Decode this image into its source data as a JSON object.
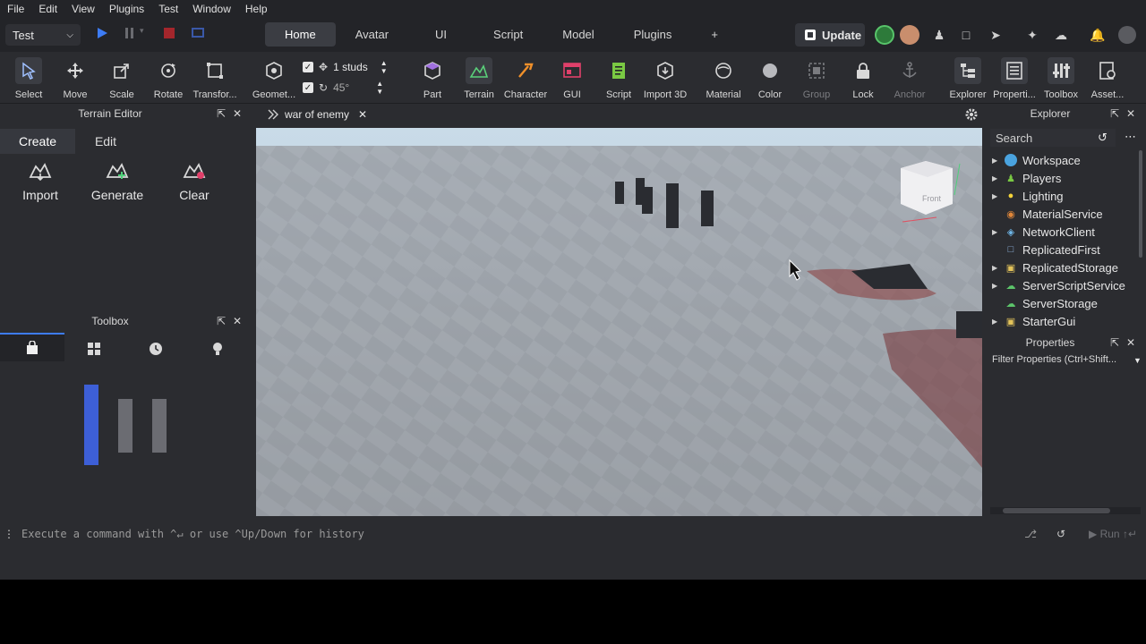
{
  "menu": [
    "File",
    "Edit",
    "View",
    "Plugins",
    "Test",
    "Window",
    "Help"
  ],
  "test_select": {
    "value": "Test"
  },
  "tabs": [
    "Home",
    "Avatar",
    "UI",
    "Script",
    "Model",
    "Plugins",
    "+"
  ],
  "active_tab": "Home",
  "update_label": "Update",
  "ribbon": {
    "tools": [
      {
        "label": "Select",
        "icon": "select-cursor-icon"
      },
      {
        "label": "Move",
        "icon": "move-arrows-icon"
      },
      {
        "label": "Scale",
        "icon": "scale-icon"
      },
      {
        "label": "Rotate",
        "icon": "rotate-icon"
      },
      {
        "label": "Transfor...",
        "icon": "transform-icon"
      },
      {
        "label": "Geomet...",
        "icon": "geometry-icon"
      }
    ],
    "snap_move": "1 studs",
    "snap_rotate": "45°",
    "insert": [
      {
        "label": "Part",
        "icon": "part-icon"
      },
      {
        "label": "Terrain",
        "icon": "terrain-icon"
      },
      {
        "label": "Character",
        "icon": "character-icon"
      },
      {
        "label": "GUI",
        "icon": "gui-icon"
      },
      {
        "label": "Script",
        "icon": "script-icon"
      },
      {
        "label": "Import 3D",
        "icon": "import-3d-icon"
      },
      {
        "label": "Material",
        "icon": "material-icon"
      },
      {
        "label": "Color",
        "icon": "color-icon"
      },
      {
        "label": "Group",
        "icon": "group-icon"
      },
      {
        "label": "Lock",
        "icon": "lock-icon"
      },
      {
        "label": "Anchor",
        "icon": "anchor-icon"
      },
      {
        "label": "Explorer",
        "icon": "explorer-icon"
      },
      {
        "label": "Properti...",
        "icon": "properties-icon"
      },
      {
        "label": "Toolbox",
        "icon": "toolbox-icon"
      },
      {
        "label": "Asset...",
        "icon": "asset-manager-icon"
      }
    ]
  },
  "terrain_editor": {
    "title": "Terrain Editor",
    "tabs": [
      "Create",
      "Edit"
    ],
    "actions": [
      "Import",
      "Generate",
      "Clear"
    ]
  },
  "toolbox": {
    "title": "Toolbox"
  },
  "document_tab": "war of enemy",
  "explorer": {
    "title": "Explorer",
    "search_placeholder": "Search",
    "items": [
      {
        "label": "Workspace",
        "expandable": true,
        "color": "#4aa3df"
      },
      {
        "label": "Players",
        "expandable": true,
        "color": "#7ac943"
      },
      {
        "label": "Lighting",
        "expandable": true,
        "color": "#f5d33a"
      },
      {
        "label": "MaterialService",
        "expandable": false,
        "color": "#e0873a"
      },
      {
        "label": "NetworkClient",
        "expandable": true,
        "color": "#6fb7e8"
      },
      {
        "label": "ReplicatedFirst",
        "expandable": false,
        "color": "#8fb5e0"
      },
      {
        "label": "ReplicatedStorage",
        "expandable": true,
        "color": "#e3c35a"
      },
      {
        "label": "ServerScriptService",
        "expandable": true,
        "color": "#5cc46a"
      },
      {
        "label": "ServerStorage",
        "expandable": false,
        "color": "#5cc46a"
      },
      {
        "label": "StarterGui",
        "expandable": true,
        "color": "#e3c35a"
      }
    ]
  },
  "properties": {
    "title": "Properties",
    "filter_placeholder": "Filter Properties (Ctrl+Shift..."
  },
  "command_bar": {
    "placeholder": "Execute a command with ^↵ or use ^Up/Down for history",
    "run_label": "Run ↑↵"
  },
  "viewcube_label": "Front"
}
